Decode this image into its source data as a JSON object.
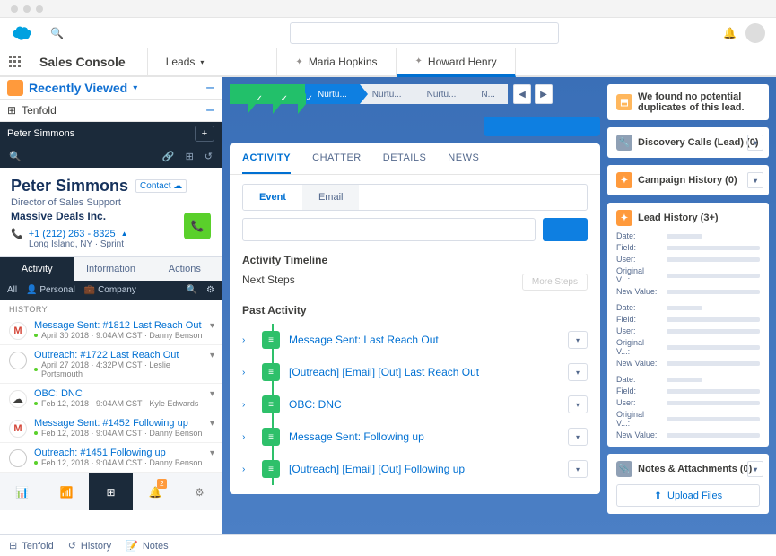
{
  "app_name": "Sales Console",
  "nav": {
    "items": [
      "Leads"
    ],
    "workspace_tabs": [
      {
        "label": "Maria Hopkins",
        "active": false
      },
      {
        "label": "Howard Henry",
        "active": true
      }
    ]
  },
  "sidebar": {
    "recently_viewed": "Recently Viewed",
    "tenfold_label": "Tenfold",
    "contact_bar_name": "Peter Simmons",
    "person": {
      "name": "Peter Simmons",
      "contact_tag": "Contact",
      "title": "Director of Sales Support",
      "company": "Massive Deals Inc.",
      "phone": "+1 (212) 263 - 8325",
      "phone_suffix": "▲",
      "location": "Long Island, NY · Sprint"
    },
    "tabs": {
      "activity": "Activity",
      "info": "Information",
      "actions": "Actions"
    },
    "filters": {
      "all": "All",
      "personal": "Personal",
      "company": "Company"
    },
    "history_label": "HISTORY",
    "history": [
      {
        "type": "gmail",
        "title": "Message Sent: #1812 Last Reach Out",
        "meta": "April 30 2018 · 9:04AM CST · Danny Benson"
      },
      {
        "type": "outreach",
        "title": "Outreach: #1722 Last Reach Out",
        "meta": "April 27 2018 · 4:32PM CST · Leslie Portsmouth"
      },
      {
        "type": "sf",
        "title": "OBC: DNC",
        "meta": "Feb 12, 2018 · 9:04AM CST · Kyle Edwards"
      },
      {
        "type": "gmail",
        "title": "Message Sent: #1452 Following up",
        "meta": "Feb 12, 2018 · 9:04AM CST · Danny Benson"
      },
      {
        "type": "outreach",
        "title": "Outreach: #1451 Following up",
        "meta": "Feb 12, 2018 · 9:04AM CST · Danny Benson"
      }
    ],
    "bottom_tools_badge": "2"
  },
  "path_stages": {
    "active": "Nurtu...",
    "pending": [
      "Nurtu...",
      "Nurtu...",
      "N..."
    ]
  },
  "activity_card": {
    "tabs": {
      "activity": "ACTIVITY",
      "chatter": "CHATTER",
      "details": "DETAILS",
      "news": "NEWS"
    },
    "event_tabs": {
      "event": "Event",
      "email": "Email"
    },
    "timeline_label": "Activity Timeline",
    "next_steps_label": "Next Steps",
    "more_steps": "More Steps",
    "past_label": "Past Activity",
    "past": [
      "Message Sent: Last Reach Out",
      "[Outreach] [Email] [Out] Last Reach Out",
      "OBC: DNC",
      "Message Sent: Following up",
      "[Outreach] [Email] [Out] Following up"
    ]
  },
  "right": {
    "dupes": "We found no potential duplicates of this lead.",
    "discovery": "Discovery Calls (Lead) (0)",
    "campaign": "Campaign History (0)",
    "lead_history": "Lead History (3+)",
    "lh_keys": [
      "Date:",
      "Field:",
      "User:",
      "Original V...:",
      "New Value:"
    ],
    "notes": "Notes & Attachments (0)",
    "upload": "Upload Files"
  },
  "footer": {
    "tenfold": "Tenfold",
    "history": "History",
    "notes": "Notes"
  }
}
